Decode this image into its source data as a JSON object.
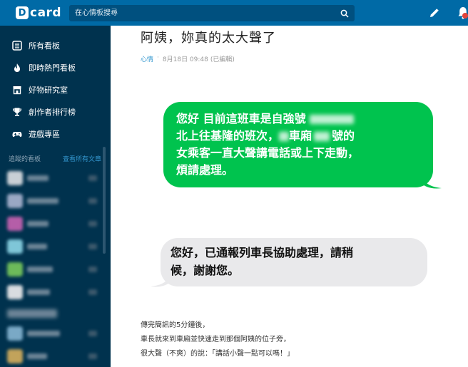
{
  "header": {
    "logo_mark": "D",
    "logo_text": "card",
    "search_placeholder": "在心情板搜尋",
    "icons": [
      "search-icon",
      "pen-icon",
      "bell-icon"
    ],
    "accent": "#006aa6"
  },
  "sidebar": {
    "items": [
      {
        "label": "所有看板",
        "icon": "list-icon"
      },
      {
        "label": "即時熱門看板",
        "icon": "flame-icon"
      },
      {
        "label": "好物研究室",
        "icon": "shop-icon"
      },
      {
        "label": "創作者排行榜",
        "icon": "trophy-icon"
      },
      {
        "label": "遊戲專區",
        "icon": "gamepad-icon"
      }
    ],
    "followed_title": "追蹤的看板",
    "followed_link": "查看所有文章",
    "bg": "#00324e"
  },
  "post": {
    "title": "阿姨，妳真的太大聲了",
    "forum": "心情",
    "date": "8月18日 09:48",
    "edited": "(已編輯)",
    "sent_lines": [
      "您好 目前這班車是自強號",
      "北上往基隆的班次，",
      "車廂",
      "號的",
      "女乘客一直大聲講電話或上下走動，",
      "煩請處理。"
    ],
    "reply_lines": [
      "您好，已通報列車長協助處理，請稍",
      "候，謝謝您。"
    ],
    "body_lines": [
      "傳完簡訊的5分鐘後，",
      "車長就來到車廂並快速走到那個阿姨的位子旁，",
      "很大聲（不爽）的說：「講話小聲一點可以嗎！」"
    ],
    "sent_color": "#00c34e",
    "reply_color": "#e9e9eb"
  }
}
